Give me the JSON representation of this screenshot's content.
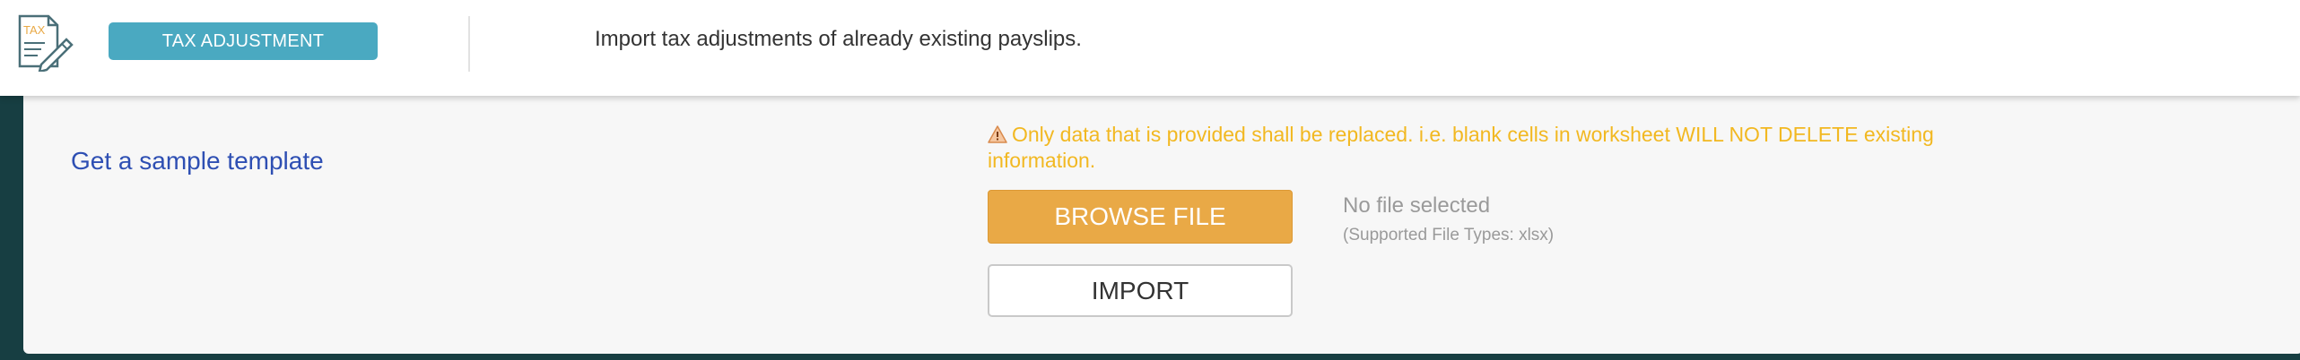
{
  "header": {
    "logo_icon": "tax-document-icon",
    "logo_text": "TAX",
    "module_label": "TAX ADJUSTMENT",
    "description": "Import tax adjustments of already existing payslips."
  },
  "main": {
    "sample_link": "Get a sample template",
    "warning_icon": "warning-triangle-icon",
    "warning_text": "Only data that is provided shall be replaced. i.e. blank cells in worksheet WILL NOT DELETE existing information.",
    "browse_label": "BROWSE FILE",
    "file_status": "No file selected",
    "file_types": "(Supported File Types: xlsx)",
    "import_label": "IMPORT"
  },
  "colors": {
    "badge": "#4aa9c1",
    "backdrop": "#173e42",
    "link": "#2e4fb3",
    "warning": "#f2b821",
    "browse": "#e9a946"
  }
}
